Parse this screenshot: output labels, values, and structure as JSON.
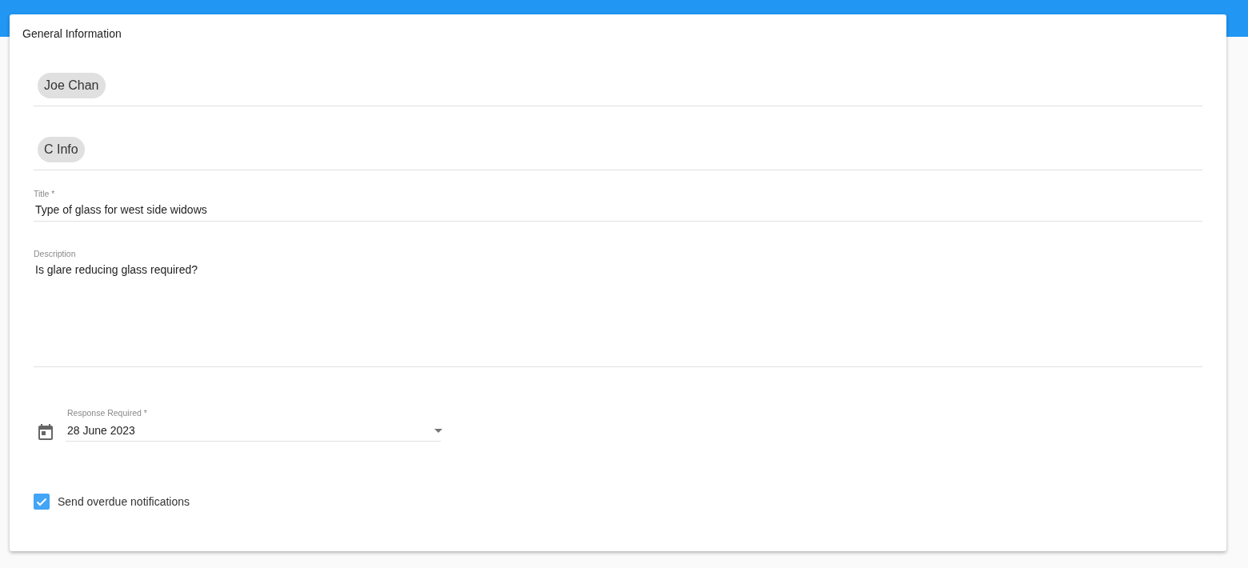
{
  "card": {
    "title": "General Information"
  },
  "chip_fields": [
    {
      "chips": [
        {
          "label": "Joe Chan"
        }
      ]
    },
    {
      "chips": [
        {
          "label": "C Info"
        }
      ]
    }
  ],
  "fields": [
    {
      "kind": "text",
      "label": "Title *",
      "value": "Type of glass for west side widows"
    },
    {
      "kind": "textarea",
      "label": "Description",
      "value": "Is glare reducing glass required?"
    },
    {
      "kind": "date",
      "label": "Response Required *",
      "value": "28 June 2023"
    }
  ],
  "checkbox": {
    "label": "Send overdue notifications",
    "checked": true
  }
}
